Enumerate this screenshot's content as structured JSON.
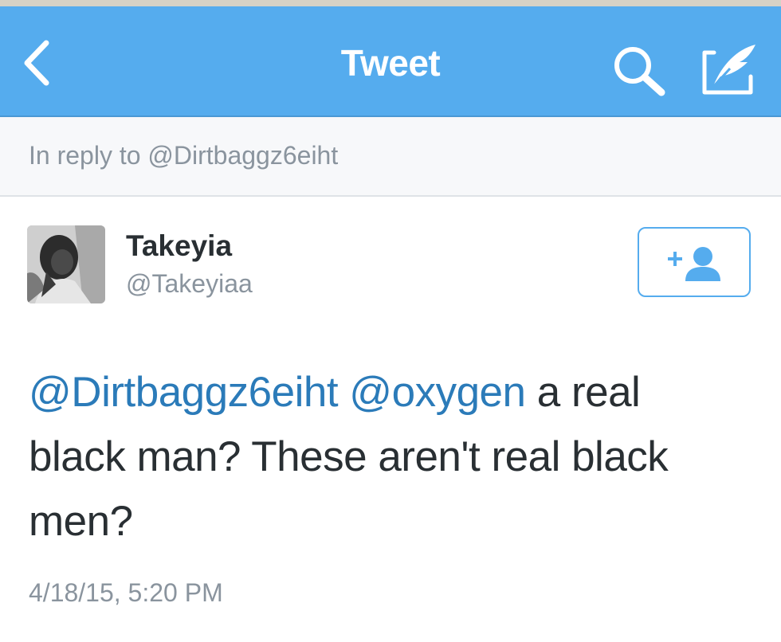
{
  "nav": {
    "title": "Tweet",
    "back_icon": "chevron-left-icon",
    "search_icon": "search-icon",
    "compose_icon": "compose-tweet-icon"
  },
  "reply": {
    "text": "In reply to @Dirtbaggz6eiht"
  },
  "tweet": {
    "author_name": "Takeyia",
    "author_handle": "@Takeyiaa",
    "mention_1": "@Dirtbaggz6eiht",
    "mention_2": "@oxygen",
    "body": "a real black man? These aren't real black men?",
    "timestamp": "4/18/15, 5:20 PM",
    "follow_icon": "add-user-icon"
  },
  "colors": {
    "brand": "#55acee",
    "link": "#2b7bb9",
    "text": "#292f33",
    "muted": "#8a949e"
  }
}
